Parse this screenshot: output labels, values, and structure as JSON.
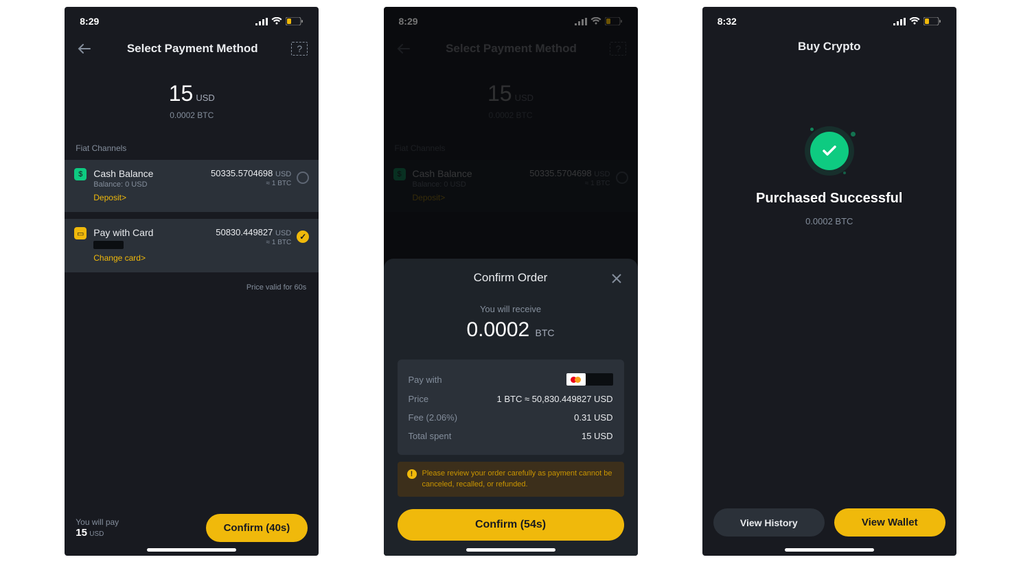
{
  "status": {
    "time1": "8:29",
    "time2": "8:29",
    "time3": "8:32"
  },
  "screen1": {
    "header_title": "Select Payment Method",
    "amount_value": "15",
    "amount_currency": "USD",
    "amount_sub": "0.0002 BTC",
    "section_label": "Fiat Channels",
    "row_cash": {
      "title": "Cash Balance",
      "sub": "Balance:  0 USD",
      "link": "Deposit>",
      "rate_value": "50335.5704698",
      "rate_currency": "USD",
      "rate_eq": "≈ 1 BTC"
    },
    "row_card": {
      "title": "Pay with Card",
      "link": "Change card>",
      "rate_value": "50830.449827",
      "rate_currency": "USD",
      "rate_eq": "≈ 1  BTC"
    },
    "price_valid": "Price valid for 60s",
    "footer_label": "You will pay",
    "footer_amount": "15",
    "footer_currency": "USD",
    "confirm_label": "Confirm (40s)"
  },
  "screen2": {
    "header_title": "Select Payment Method",
    "amount_value": "15",
    "amount_currency": "USD",
    "amount_sub": "0.0002 BTC",
    "section_label": "Fiat Channels",
    "row_cash": {
      "title": "Cash Balance",
      "sub": "Balance:  0 USD",
      "link": "Deposit>",
      "rate_value": "50335.5704698",
      "rate_currency": "USD",
      "rate_eq": "≈ 1 BTC"
    },
    "sheet": {
      "title": "Confirm Order",
      "receive_label": "You will receive",
      "receive_value": "0.0002",
      "receive_currency": "BTC",
      "paywith_label": "Pay with",
      "price_label": "Price",
      "price_value": "1 BTC ≈ 50,830.449827 USD",
      "fee_label": "Fee (2.06%)",
      "fee_value": "0.31 USD",
      "total_label": "Total spent",
      "total_value": "15 USD",
      "warning": "Please review your order carefully as payment cannot be canceled, recalled, or refunded.",
      "confirm_label": "Confirm (54s)"
    }
  },
  "screen3": {
    "header_title": "Buy Crypto",
    "success_title": "Purchased Successful",
    "success_sub": "0.0002 BTC",
    "btn_history": "View History",
    "btn_wallet": "View Wallet"
  }
}
